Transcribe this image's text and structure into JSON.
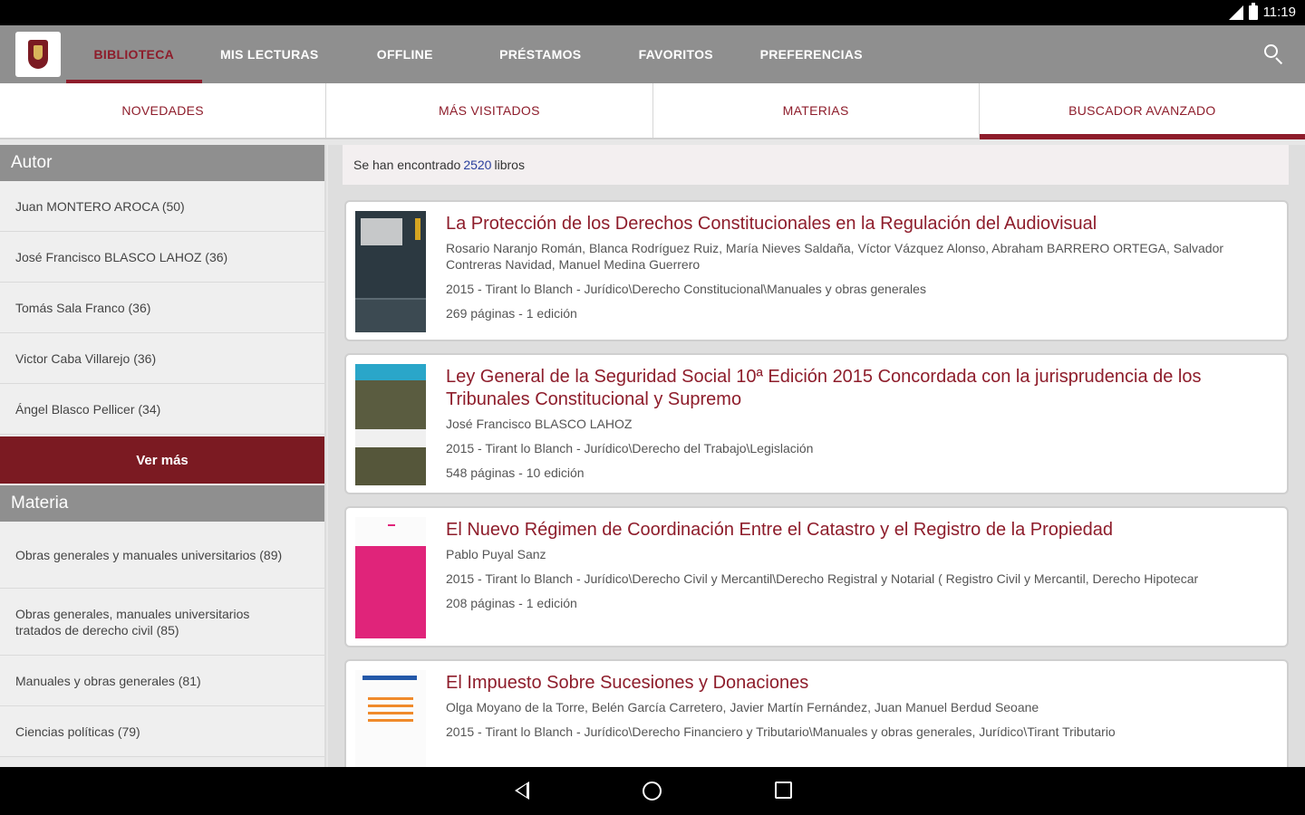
{
  "status_bar": {
    "time": "11:19"
  },
  "top_nav": {
    "items": [
      {
        "label": "BIBLIOTECA"
      },
      {
        "label": "MIS LECTURAS"
      },
      {
        "label": "OFFLINE"
      },
      {
        "label": "PRÉSTAMOS"
      },
      {
        "label": "FAVORITOS"
      },
      {
        "label": "PREFERENCIAS"
      }
    ],
    "active": "BIBLIOTECA"
  },
  "sub_tabs": {
    "items": [
      {
        "label": "NOVEDADES"
      },
      {
        "label": "MÁS VISITADOS"
      },
      {
        "label": "MATERIAS"
      },
      {
        "label": "BUSCADOR AVANZADO"
      }
    ],
    "active": "BUSCADOR AVANZADO"
  },
  "sidebar": {
    "autor": {
      "header": "Autor",
      "items": [
        {
          "label": "Juan MONTERO AROCA (50)"
        },
        {
          "label": "José Francisco BLASCO LAHOZ (36)"
        },
        {
          "label": "Tomás Sala Franco (36)"
        },
        {
          "label": "Victor Caba Villarejo (36)"
        },
        {
          "label": "Ángel Blasco Pellicer (34)"
        }
      ],
      "more_label": "Ver más"
    },
    "materia": {
      "header": "Materia",
      "items": [
        {
          "label": "Obras generales y manuales universitarios (89)"
        },
        {
          "label": "Obras generales, manuales universitarios tratados de derecho civil (85)"
        },
        {
          "label": "Manuales y obras generales (81)"
        },
        {
          "label": "Ciencias políticas (79)"
        }
      ]
    }
  },
  "results": {
    "prefix": "Se han encontrado",
    "count": "2520",
    "suffix": "libros"
  },
  "books": [
    {
      "title": "La Protección de los Derechos Constitucionales en la Regulación del Audiovisual",
      "authors": "Rosario Naranjo Román,  Blanca Rodríguez Ruiz,  María Nieves Saldaña, Víctor Vázquez Alonso, Abraham BARRERO ORTEGA, Salvador Contreras Navidad, Manuel Medina Guerrero",
      "meta": "2015 - Tirant lo Blanch - Jurídico\\Derecho Constitucional\\Manuales y obras generales",
      "pages": "269 páginas - 1 edición"
    },
    {
      "title": "Ley General de la Seguridad Social 10ª Edición 2015 Concordada con la jurisprudencia de los Tribunales Constitucional y Supremo",
      "authors": "José Francisco BLASCO LAHOZ",
      "meta": "2015 - Tirant lo Blanch - Jurídico\\Derecho del Trabajo\\Legislación",
      "pages": "548 páginas - 10 edición"
    },
    {
      "title": "El Nuevo Régimen de Coordinación Entre el Catastro y el Registro de la Propiedad",
      "authors": "Pablo Puyal Sanz",
      "meta": "2015 - Tirant lo Blanch - Jurídico\\Derecho Civil y Mercantil\\Derecho Registral y Notarial ( Registro Civil y Mercantil, Derecho Hipotecar",
      "pages": "208 páginas - 1 edición"
    },
    {
      "title": "El Impuesto Sobre Sucesiones y Donaciones",
      "authors": "Olga Moyano de la Torre,  Belén García Carretero, Javier Martín Fernández,  Juan Manuel Berdud Seoane",
      "meta": "2015 - Tirant lo Blanch - Jurídico\\Derecho Financiero y Tributario\\Manuales y obras generales, Jurídico\\Tirant Tributario",
      "pages": ""
    }
  ]
}
